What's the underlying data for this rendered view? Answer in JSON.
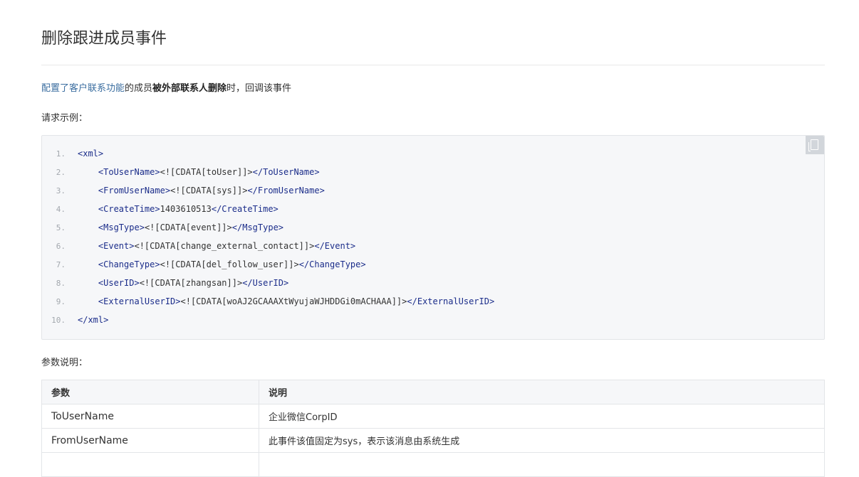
{
  "page": {
    "title": "删除跟进成员事件",
    "intro": {
      "link_text": "配置了客户联系功能",
      "text_1": "的成员",
      "bold_text": "被外部联系人删除",
      "text_2": "时，回调该事件"
    },
    "request_example_label": "请求示例：",
    "params_label": "参数说明："
  },
  "code_block": {
    "copy_icon": "copy-icon",
    "lines": [
      {
        "num": "1.",
        "tag_open": "<xml>",
        "value": "",
        "tag_close": "",
        "indent": false
      },
      {
        "num": "2.",
        "tag_open": "<ToUserName>",
        "value": "<![CDATA[toUser]]>",
        "tag_close": "</ToUserName>",
        "indent": true
      },
      {
        "num": "3.",
        "tag_open": "<FromUserName>",
        "value": "<![CDATA[sys]]>",
        "tag_close": "</FromUserName>",
        "indent": true
      },
      {
        "num": "4.",
        "tag_open": "<CreateTime>",
        "value": "1403610513",
        "tag_close": "</CreateTime>",
        "indent": true
      },
      {
        "num": "5.",
        "tag_open": "<MsgType>",
        "value": "<![CDATA[event]]>",
        "tag_close": "</MsgType>",
        "indent": true
      },
      {
        "num": "6.",
        "tag_open": "<Event>",
        "value": "<![CDATA[change_external_contact]]>",
        "tag_close": "</Event>",
        "indent": true
      },
      {
        "num": "7.",
        "tag_open": "<ChangeType>",
        "value": "<![CDATA[del_follow_user]]>",
        "tag_close": "</ChangeType>",
        "indent": true
      },
      {
        "num": "8.",
        "tag_open": "<UserID>",
        "value": "<![CDATA[zhangsan]]>",
        "tag_close": "</UserID>",
        "indent": true
      },
      {
        "num": "9.",
        "tag_open": "<ExternalUserID>",
        "value": "<![CDATA[woAJ2GCAAAXtWyujaWJHDDGi0mACHAAA]]>",
        "tag_close": "</ExternalUserID>",
        "indent": true
      },
      {
        "num": "10.",
        "tag_open": "</xml>",
        "value": "",
        "tag_close": "",
        "indent": false
      }
    ]
  },
  "param_table": {
    "headers": [
      "参数",
      "说明"
    ],
    "rows": [
      [
        "ToUserName",
        "企业微信CorpID"
      ],
      [
        "FromUserName",
        "此事件该值固定为sys，表示该消息由系统生成"
      ]
    ]
  },
  "colors": {
    "link": "#3b6ea0",
    "xml_tag": "#1b2d8a",
    "code_bg": "#f6f7f9",
    "border": "#e3e5e8"
  }
}
